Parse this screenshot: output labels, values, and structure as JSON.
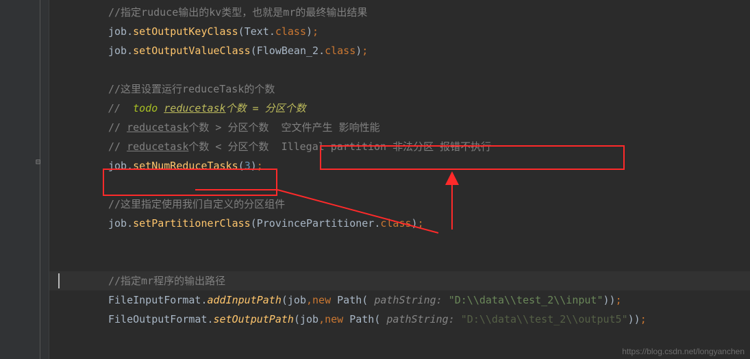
{
  "code": {
    "l1_comment": "//指定ruduce输出的kv类型，也就是mr的最终输出结果",
    "l2_job": "job",
    "l2_dot": ".",
    "l2_method": "setOutputKeyClass",
    "l2_arg_class": "Text",
    "l2_arg_dot": ".",
    "l2_arg_kw": "class",
    "l3_method": "setOutputValueClass",
    "l3_arg_class": "FlowBean_2",
    "l5_comment": "//这里设置运行reduceTask的个数",
    "l6_prefix": "//  ",
    "l6_todo": "todo ",
    "l6_u": "reducetask",
    "l6_rest": "个数 = 分区个数",
    "l7_prefix": "// ",
    "l7_u": "reducetask",
    "l7_rest": "个数 > 分区个数  空文件产生 影响性能",
    "l8_prefix": "// ",
    "l8_u": "reducetask",
    "l8_rest1": "个数 < 分区个数  ",
    "l8_rest2": "Illegal partition 非法分区 报错不执行",
    "l9_method": "setNumReduceTasks",
    "l9_num": "3",
    "l11_comment": "//这里指定使用我们自定义的分区组件",
    "l12_method": "setPartitionerClass",
    "l12_arg_class": "ProvincePartitioner",
    "l14_comment": "//指定mr程序的输出路径",
    "l15_cls": "FileInputFormat",
    "l15_method": "addInputPath",
    "l15_job": "job",
    "l15_new": "new",
    "l15_path": "Path",
    "l15_hint": " pathString: ",
    "l15_str": "\"D:\\\\data\\\\test_2\\\\input\"",
    "l16_cls": "FileOutputFormat",
    "l16_method": "setOutputPath",
    "l16_str": "\"D:\\\\data\\\\test_2\\\\output5\""
  },
  "watermark": "https://blog.csdn.net/longyanchen"
}
